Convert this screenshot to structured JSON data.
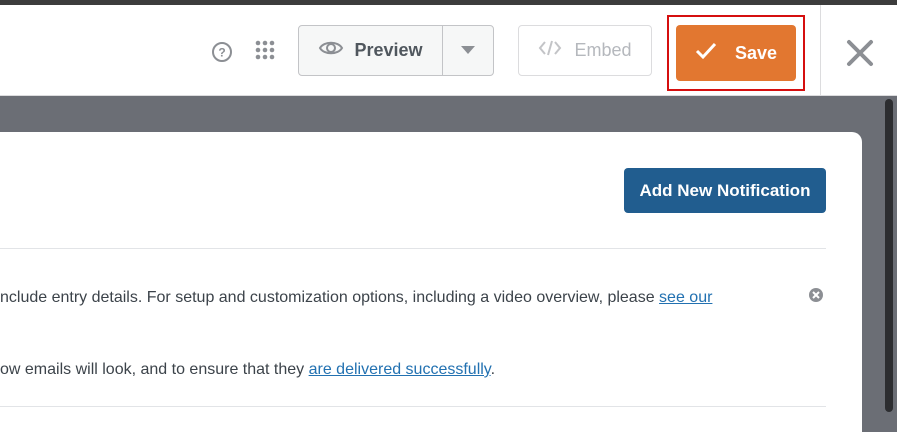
{
  "toolbar": {
    "preview_label": "Preview",
    "embed_label": "Embed",
    "save_label": "Save"
  },
  "icons": {
    "help": "help-circle-icon",
    "grid": "grid-dots-icon",
    "eye": "eye-icon",
    "caret": "caret-down-icon",
    "code": "code-icon",
    "check": "check-icon",
    "close": "close-icon",
    "dismiss": "dismiss-circle-icon"
  },
  "panel": {
    "add_button_label": "Add New Notification",
    "notice": {
      "line1_text": "nclude entry details. For setup and customization options, including a video overview, please ",
      "line1_link": "see our",
      "line2_text": "ow emails will look, and to ensure that they ",
      "line2_link": "are delivered successfully",
      "line2_end": "."
    }
  },
  "colors": {
    "save": "#e27730",
    "add_button": "#215d8f",
    "highlight": "#d50f0f",
    "link": "#2271b1"
  }
}
